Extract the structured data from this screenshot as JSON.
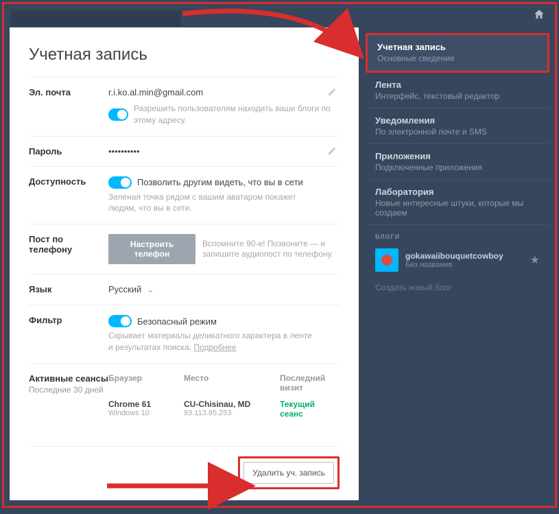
{
  "page_title": "Учетная запись",
  "email": {
    "label": "Эл. почта",
    "value": "r.i.ko.al.min@gmail.com",
    "toggle_hint": "Разрешить пользователям находить ваши блоги по этому адресу."
  },
  "password": {
    "label": "Пароль",
    "value": "••••••••••"
  },
  "availability": {
    "label": "Доступность",
    "toggle_label": "Позволить другим видеть, что вы в сети",
    "hint": "Зеленая точка рядом с вашим аватаром покажет людям, что вы в сети."
  },
  "phone_post": {
    "label": "Пост по телефону",
    "button": "Настроить телефон",
    "hint": "Вспомните 90-е! Позвоните — и запишите аудиопост по телефону."
  },
  "language": {
    "label": "Язык",
    "value": "Русский"
  },
  "filter": {
    "label": "Фильтр",
    "toggle_label": "Безопасный режим",
    "hint": "Скрывает материалы деликатного характера в ленте и результатах поиска. ",
    "more": "Подробнее"
  },
  "sessions": {
    "label": "Активные сеансы",
    "sublabel": "Последние 30 дней",
    "cols": {
      "browser": "Браузер",
      "place": "Место",
      "last": "Последний визит"
    },
    "row": {
      "browser": "Chrome 61",
      "os": "Windows 10",
      "place": "CU-Chisinau, MD",
      "ip": "93.113.85.253",
      "last": "Текущий сеанс"
    }
  },
  "delete_label": "Удалить уч. запись",
  "sidebar": {
    "items": [
      {
        "t": "Учетная запись",
        "d": "Основные сведения"
      },
      {
        "t": "Лента",
        "d": "Интерфейс, текстовый редактор"
      },
      {
        "t": "Уведомления",
        "d": "По электронной почте и SMS"
      },
      {
        "t": "Приложения",
        "d": "Подключенные приложения"
      },
      {
        "t": "Лаборатория",
        "d": "Новые интересные штуки, которые мы создаем"
      }
    ],
    "blogs_header": "БЛОГИ",
    "blog": {
      "name": "gokawaiibouquetcowboy",
      "sub": "Без названия"
    },
    "new_blog": "Создать новый блог"
  }
}
